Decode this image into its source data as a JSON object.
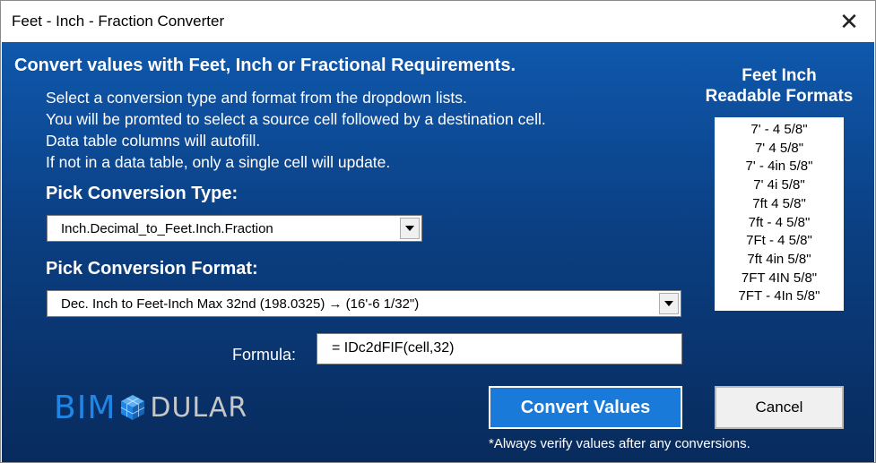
{
  "window": {
    "title": "Feet - Inch - Fraction Converter",
    "close_glyph": "✕"
  },
  "heading": "Convert values with Feet, Inch or Fractional Requirements.",
  "instructions": [
    "Select a conversion type and format from the dropdown lists.",
    "You will be promted to select a source cell followed by a destination cell.",
    "Data table columns will autofill.",
    "If not in a data table, only a single cell will update."
  ],
  "conversion_type": {
    "label": "Pick Conversion Type:",
    "selected": "Inch.Decimal_to_Feet.Inch.Fraction"
  },
  "conversion_format": {
    "label": "Pick Conversion Format:",
    "selected": "Dec. Inch to Feet-Inch Max 32nd  (198.0325) → (16'-6  1/32\")"
  },
  "formula": {
    "label": "Formula:",
    "value": " = IDc2dFIF(cell,32)"
  },
  "readable_formats": {
    "title_line1": "Feet Inch",
    "title_line2": "Readable Formats",
    "items": [
      "7' - 4 5/8\"",
      "7'  4 5/8\"",
      "7' - 4in 5/8\"",
      "7' 4i 5/8\"",
      "7ft 4 5/8\"",
      "7ft - 4 5/8\"",
      "7Ft - 4 5/8\"",
      "7ft 4in 5/8\"",
      "7FT 4IN 5/8\"",
      "7FT - 4In 5/8\""
    ]
  },
  "logo": {
    "part1": "BIM",
    "part2": "DULAR",
    "icon": "cube-icon"
  },
  "buttons": {
    "convert": "Convert Values",
    "cancel": "Cancel"
  },
  "note": "*Always verify values after any conversions.",
  "colors": {
    "background_top": "#0f58ad",
    "background_bottom": "#082b5d",
    "convert_button": "#1a7ad9",
    "logo_blue": "#1f86e6",
    "logo_gray": "#c7c7c7"
  }
}
